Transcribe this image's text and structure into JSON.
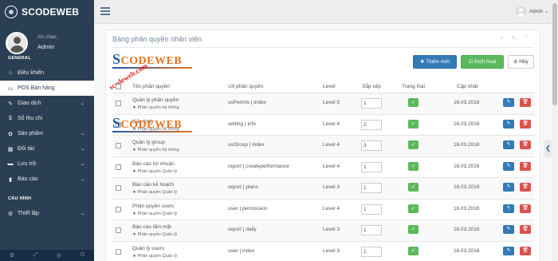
{
  "brand": {
    "logo_icon": "paw-icon",
    "name": "SCODEWEB"
  },
  "profile": {
    "greeting": "Xin chào,",
    "username": "Admin",
    "section": "GENERAL"
  },
  "sidebar": {
    "items": [
      {
        "icon": "home-icon",
        "glyph": "⌂",
        "label": "Điều khiển",
        "chevron": ""
      },
      {
        "icon": "desktop-icon",
        "glyph": "▭",
        "label": "POS Bán hàng",
        "chevron": "",
        "active": true
      },
      {
        "icon": "edit-icon",
        "glyph": "✎",
        "label": "Giao dịch",
        "chevron": "⌄"
      },
      {
        "icon": "dollar-icon",
        "glyph": "$",
        "label": "Sổ thu chi",
        "chevron": ""
      },
      {
        "icon": "cubes-icon",
        "glyph": "✿",
        "label": "Sản phẩm",
        "chevron": "⌄"
      },
      {
        "icon": "table-icon",
        "glyph": "▦",
        "label": "Đối tác",
        "chevron": "⌄"
      },
      {
        "icon": "inbox-icon",
        "glyph": "▬",
        "label": "Lưu trữ",
        "chevron": "⌄"
      },
      {
        "icon": "bar-chart-icon",
        "glyph": "▮",
        "label": "Báo cáo",
        "chevron": "⌄"
      }
    ],
    "section2_title": "CẤU HÌNH",
    "section2_item": {
      "icon": "gear-icon",
      "glyph": "⚙",
      "label": "Thiết lập",
      "chevron": "⌄"
    }
  },
  "topbar": {
    "user_label": "Admin ⌄"
  },
  "panel": {
    "title": "Bảng phân quyền nhân viên",
    "tools": "× ✎ ⌃",
    "buttons": {
      "add": "Thêm mới",
      "activate": "Kích hoạt",
      "cancel": "Hủy"
    }
  },
  "watermark": {
    "brand": "SCODEWEB",
    "diag": "scodeweb.com"
  },
  "table": {
    "headers": {
      "name": "Tên phân quyền",
      "url": "Url phân quyền",
      "level": "Level",
      "sort": "Sắp xếp",
      "status": "Trạng thái",
      "updated": "Cập nhật"
    },
    "rows": [
      {
        "name": "Quản lý phân quyền",
        "group": "★ Phân quyền hệ thống",
        "url": "usPermis | index",
        "level": "Level 5",
        "sort": "1",
        "date": "16.03.2016"
      },
      {
        "name": "Cấu hình",
        "group": "★ Phân quyền hệ thống",
        "url": "setting | info",
        "level": "Level 4",
        "sort": "2",
        "date": "16.03.2016"
      },
      {
        "name": "Quản lý group",
        "group": "★ Phân quyền hệ thống",
        "url": "usGroup | index",
        "level": "Level 4",
        "sort": "3",
        "date": "16.03.2016"
      },
      {
        "name": "Báo cáo lợi nhuận",
        "group": "★ Phân quyền Quản lý",
        "url": "report | createperformance",
        "level": "Level 4",
        "sort": "1",
        "date": "16.03.2016"
      },
      {
        "name": "Báo cáo kế hoạch",
        "group": "★ Phân quyền Quản lý",
        "url": "report | plans",
        "level": "Level 3",
        "sort": "1",
        "date": "16.03.2016"
      },
      {
        "name": "Phân quyền users",
        "group": "★ Phân quyền Quản lý",
        "url": "user | permission",
        "level": "Level 4",
        "sort": "1",
        "date": "16.03.2016"
      },
      {
        "name": "Báo cáo tiền mặt",
        "group": "★ Phân quyền Quản lý",
        "url": "report | daily",
        "level": "Level 3",
        "sort": "1",
        "date": "16.03.2016"
      },
      {
        "name": "Quản lý users",
        "group": "★ Phân quyền Quản lý",
        "url": "user | index",
        "level": "Level 3",
        "sort": "1",
        "date": "16.03.2016"
      }
    ]
  },
  "colors": {
    "sidebar": "#2a3f54",
    "primary": "#337ab7",
    "success": "#5cb85c",
    "danger": "#d9534f"
  }
}
